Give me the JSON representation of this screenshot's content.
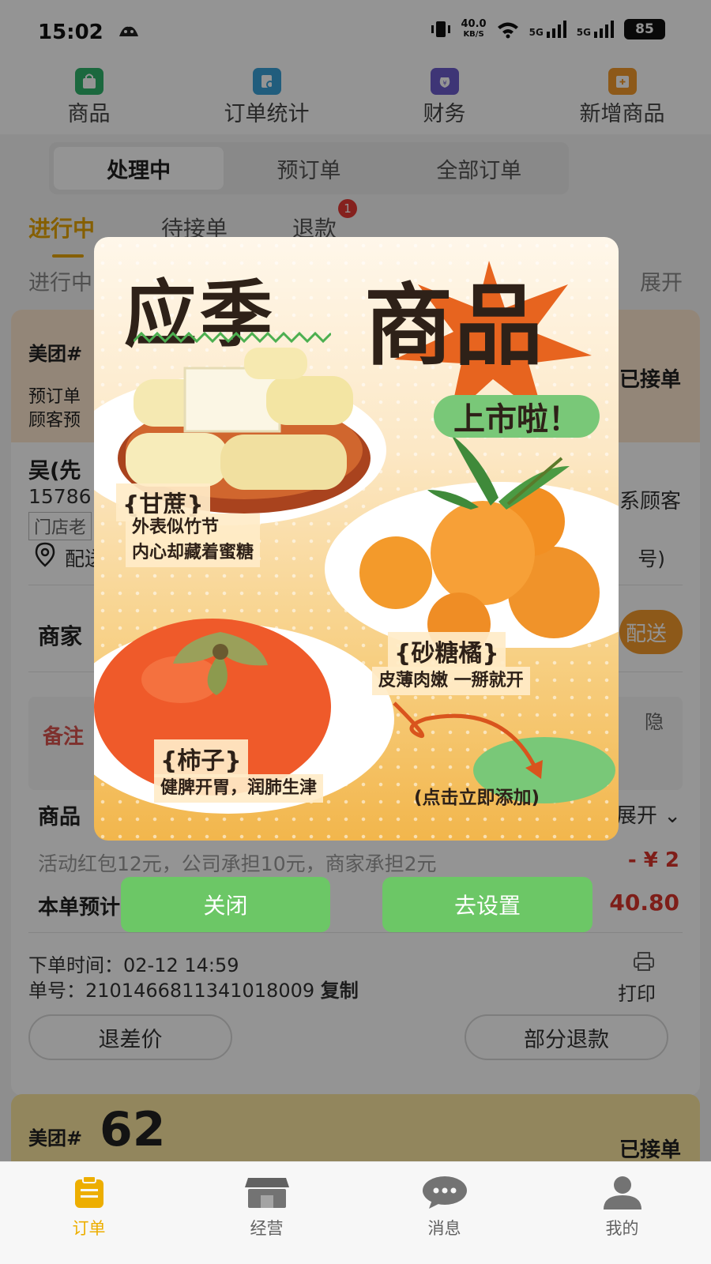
{
  "status_bar": {
    "time": "15:02",
    "net_speed": "40.0",
    "net_unit": "KB/S",
    "signal1": "5G",
    "signal2": "5G",
    "battery": "85"
  },
  "top_nav": [
    {
      "label": "商品",
      "icon": "shopping-bag-icon",
      "color": "#2fb36b"
    },
    {
      "label": "订单统计",
      "icon": "order-stats-icon",
      "color": "#3aa0d8"
    },
    {
      "label": "财务",
      "icon": "money-bag-icon",
      "color": "#6b5ccc"
    },
    {
      "label": "新增商品",
      "icon": "add-product-icon",
      "color": "#f39a2b"
    }
  ],
  "segments": [
    "处理中",
    "预订单",
    "全部订单"
  ],
  "sub_tabs": [
    "进行中",
    "待接单",
    "退款"
  ],
  "refund_badge": "1",
  "sub_row": {
    "left": "进行中",
    "right": "展开"
  },
  "order": {
    "platform": "美团#",
    "status": "已接单",
    "preorder": "预订单",
    "customer_pre": "顾客预",
    "name": "吴(先",
    "phone": "15786",
    "tag": "门店老",
    "contact_customer": "联系顾客",
    "address_prefix": "配送",
    "address_suffix": "号)",
    "merchant": "商家",
    "delivery_btn": "配送",
    "remark_label": "备注",
    "privacy": "隐",
    "goods_label": "商品",
    "expand": "展开",
    "promo_text": "活动红包12元，公司承担10元，商家承担2元",
    "promo_amount": "- ¥ 2",
    "estimate_label": "本单预计收入",
    "estimate_amount": "40.80",
    "time_label": "下单时间：",
    "time_value": "02-12 14:59",
    "no_label": "单号：",
    "no_value": "2101466811341018009",
    "copy": "复制",
    "print": "打印",
    "btn_diff": "退差价",
    "btn_partial": "部分退款"
  },
  "order2": {
    "platform": "美团#",
    "number": "62",
    "status": "已接单"
  },
  "tabbar": [
    {
      "label": "订单",
      "icon": "clipboard-icon",
      "active": true
    },
    {
      "label": "经营",
      "icon": "store-icon",
      "active": false
    },
    {
      "label": "消息",
      "icon": "chat-icon",
      "active": false
    },
    {
      "label": "我的",
      "icon": "user-icon",
      "active": false
    }
  ],
  "poster": {
    "title_a": "应季",
    "title_b": "商品",
    "tagline": "上市啦！",
    "fruit1_name": "{甘蔗}",
    "fruit1_desc1": "外表似竹节",
    "fruit1_desc2": "内心却藏着蜜糖",
    "fruit2_name": "{砂糖橘}",
    "fruit2_desc": "皮薄肉嫩 一掰就开",
    "fruit3_name": "{柿子}",
    "fruit3_desc": "健脾开胃，润肺生津",
    "cta": "(点击立即添加)"
  },
  "modal": {
    "close": "关闭",
    "settings": "去设置"
  }
}
